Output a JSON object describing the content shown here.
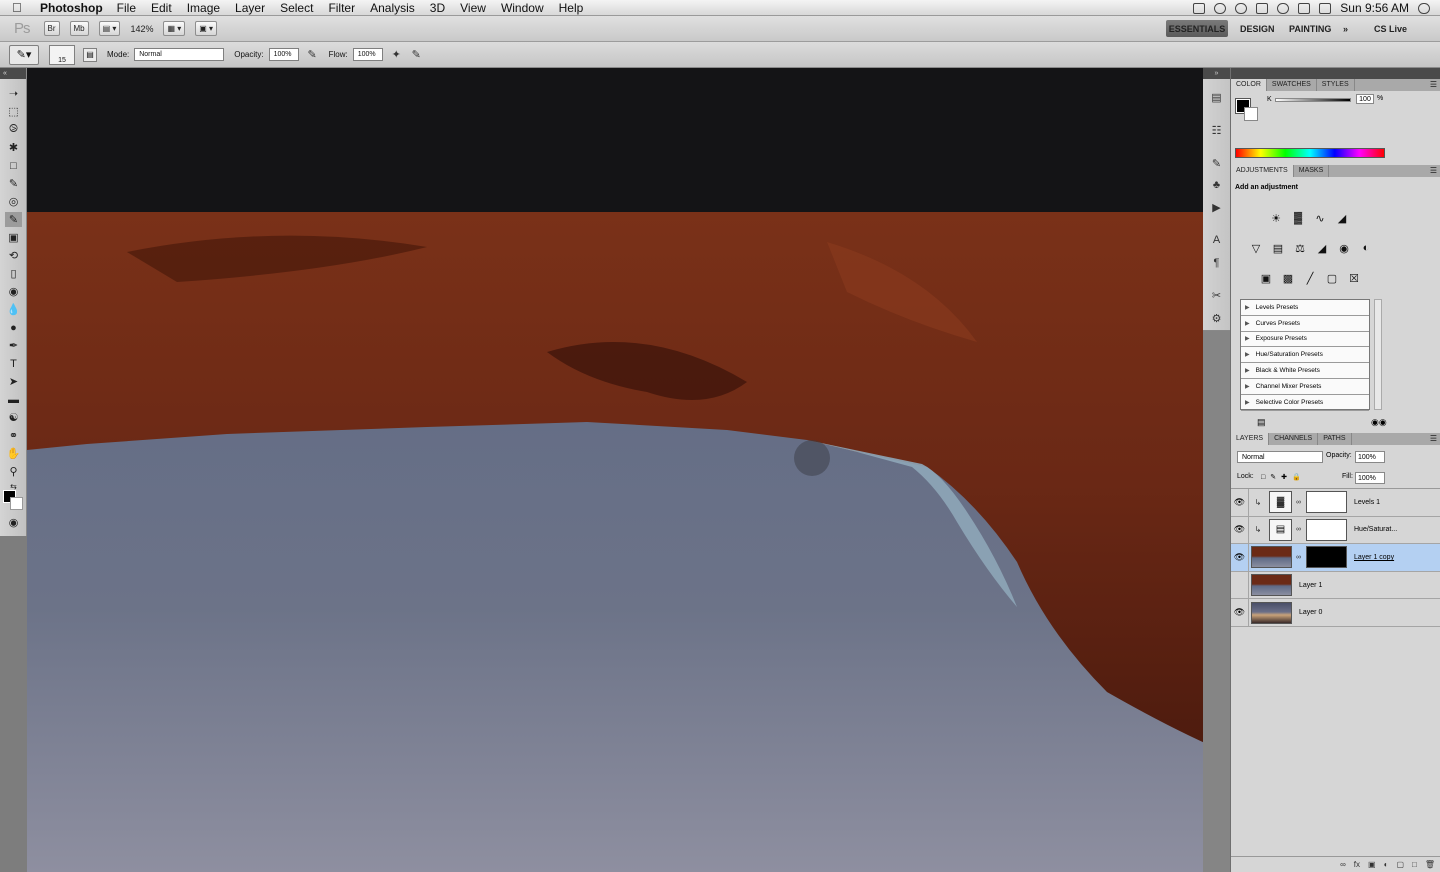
{
  "menubar": {
    "app_name": "Photoshop",
    "items": [
      "File",
      "Edit",
      "Image",
      "Layer",
      "Select",
      "Filter",
      "Analysis",
      "3D",
      "View",
      "Window",
      "Help"
    ],
    "clock": "Sun 9:56 AM"
  },
  "appbar": {
    "ps_logo": "Ps",
    "bridge": "Br",
    "minibridge": "Mb",
    "zoom": "142%",
    "workspaces": [
      "ESSENTIALS",
      "DESIGN",
      "PAINTING"
    ],
    "more": "»",
    "cs_live": "CS Live"
  },
  "options": {
    "brush_size": "15",
    "mode_label": "Mode:",
    "mode_value": "Normal",
    "opacity_label": "Opacity:",
    "opacity_value": "100%",
    "flow_label": "Flow:",
    "flow_value": "100%"
  },
  "color_panel": {
    "tabs": [
      "COLOR",
      "SWATCHES",
      "STYLES"
    ],
    "k_label": "K",
    "k_value": "100",
    "k_unit": "%"
  },
  "adjustments_panel": {
    "tabs": [
      "ADJUSTMENTS",
      "MASKS"
    ],
    "title": "Add an adjustment",
    "presets": [
      "Levels Presets",
      "Curves Presets",
      "Exposure Presets",
      "Hue/Saturation Presets",
      "Black & White Presets",
      "Channel Mixer Presets",
      "Selective Color Presets"
    ]
  },
  "layers_panel": {
    "tabs": [
      "LAYERS",
      "CHANNELS",
      "PATHS"
    ],
    "blend_mode": "Normal",
    "opacity_label": "Opacity:",
    "opacity_value": "100%",
    "lock_label": "Lock:",
    "fill_label": "Fill:",
    "fill_value": "100%",
    "layers": [
      {
        "name": "Levels 1",
        "visible": true,
        "selected": false
      },
      {
        "name": "Hue/Saturat...",
        "visible": true,
        "selected": false
      },
      {
        "name": "Layer 1 copy",
        "visible": true,
        "selected": true
      },
      {
        "name": "Layer 1",
        "visible": false,
        "selected": false
      },
      {
        "name": "Layer 0",
        "visible": true,
        "selected": false
      }
    ]
  },
  "colors": {
    "sky_top": "#5f6a86",
    "sky_bottom": "#8a8ea0",
    "rock": "#6b2a16",
    "selection": "#b4d0f2"
  }
}
